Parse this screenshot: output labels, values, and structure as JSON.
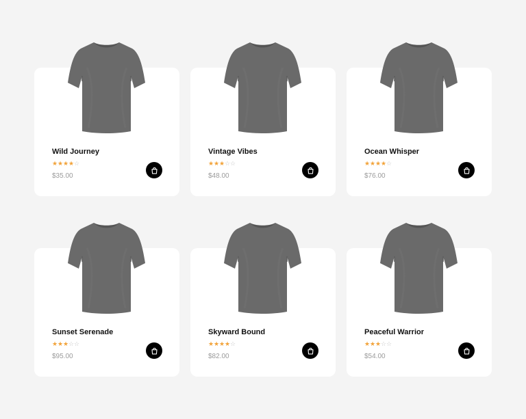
{
  "colors": {
    "background": "#f4f4f4",
    "card": "#ffffff",
    "star_filled": "#f2a33a",
    "star_empty": "#c4c4c4",
    "shirt": "#6a6a6a",
    "button": "#000000"
  },
  "icons": {
    "image": "tshirt-image",
    "cart": "shopping-bag-icon",
    "star": "star-icon"
  },
  "products": [
    {
      "name": "Wild Journey",
      "rating": 4,
      "max_rating": 5,
      "price": "$35.00"
    },
    {
      "name": "Vintage Vibes",
      "rating": 3,
      "max_rating": 5,
      "price": "$48.00"
    },
    {
      "name": "Ocean Whisper",
      "rating": 4,
      "max_rating": 5,
      "price": "$76.00"
    },
    {
      "name": "Sunset Serenade",
      "rating": 3,
      "max_rating": 5,
      "price": "$95.00"
    },
    {
      "name": "Skyward Bound",
      "rating": 4,
      "max_rating": 5,
      "price": "$82.00"
    },
    {
      "name": "Peaceful Warrior",
      "rating": 3,
      "max_rating": 5,
      "price": "$54.00"
    }
  ]
}
